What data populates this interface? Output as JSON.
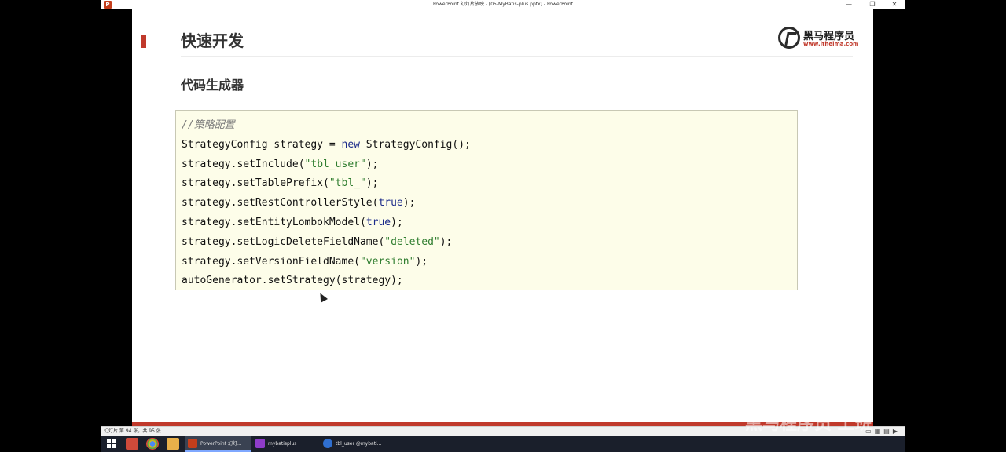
{
  "window": {
    "title": "PowerPoint 幻灯片放映 - [05-MyBatis-plus.pptx] - PowerPoint",
    "app_icon_letter": "P",
    "buttons": {
      "minimize": "—",
      "restore": "❐",
      "close": "✕"
    }
  },
  "slide": {
    "title": "快速开发",
    "subtitle": "代码生成器",
    "logo": {
      "name": "黑马程序员",
      "url": "www.itheima.com"
    },
    "code": {
      "comment": "//策略配置",
      "lines": [
        {
          "pre": "StrategyConfig strategy = ",
          "kw": "new",
          "post": " StrategyConfig();"
        },
        {
          "pre": "strategy.setInclude(",
          "str": "\"tbl_user\"",
          "post": ");"
        },
        {
          "pre": "strategy.setTablePrefix(",
          "str": "\"tbl_\"",
          "post": ");"
        },
        {
          "pre": "strategy.setRestControllerStyle(",
          "kw": "true",
          "post": ");"
        },
        {
          "pre": "strategy.setEntityLombokModel(",
          "kw": "true",
          "post": ");"
        },
        {
          "pre": "strategy.setLogicDeleteFieldName(",
          "str": "\"deleted\"",
          "post": ");"
        },
        {
          "pre": "strategy.setVersionFieldName(",
          "str": "\"version\"",
          "post": ");"
        },
        {
          "pre": "autoGenerator.setStrategy(strategy);"
        }
      ]
    },
    "colors": {
      "accent": "#c0392b",
      "code_bg": "#fdfde9",
      "keyword": "#1b2a8a",
      "string": "#2f7d2f"
    }
  },
  "statusbar": {
    "text": "幻灯片 第 94 张，共 95 张",
    "icons": [
      "normal-view-icon",
      "slide-sorter-icon",
      "reading-view-icon",
      "slideshow-icon"
    ]
  },
  "taskbar": {
    "tasks": [
      {
        "label": "PowerPoint 幻灯...",
        "icon_color": "#c43e1c",
        "active": true
      },
      {
        "label": "mybatisplus",
        "icon_color": "#8e3cc8",
        "active": false
      },
      {
        "label": "tbl_user @mybati...",
        "icon_color": "#2f6fd0",
        "active": false
      }
    ]
  },
  "watermark": "黑马程序员 上班"
}
